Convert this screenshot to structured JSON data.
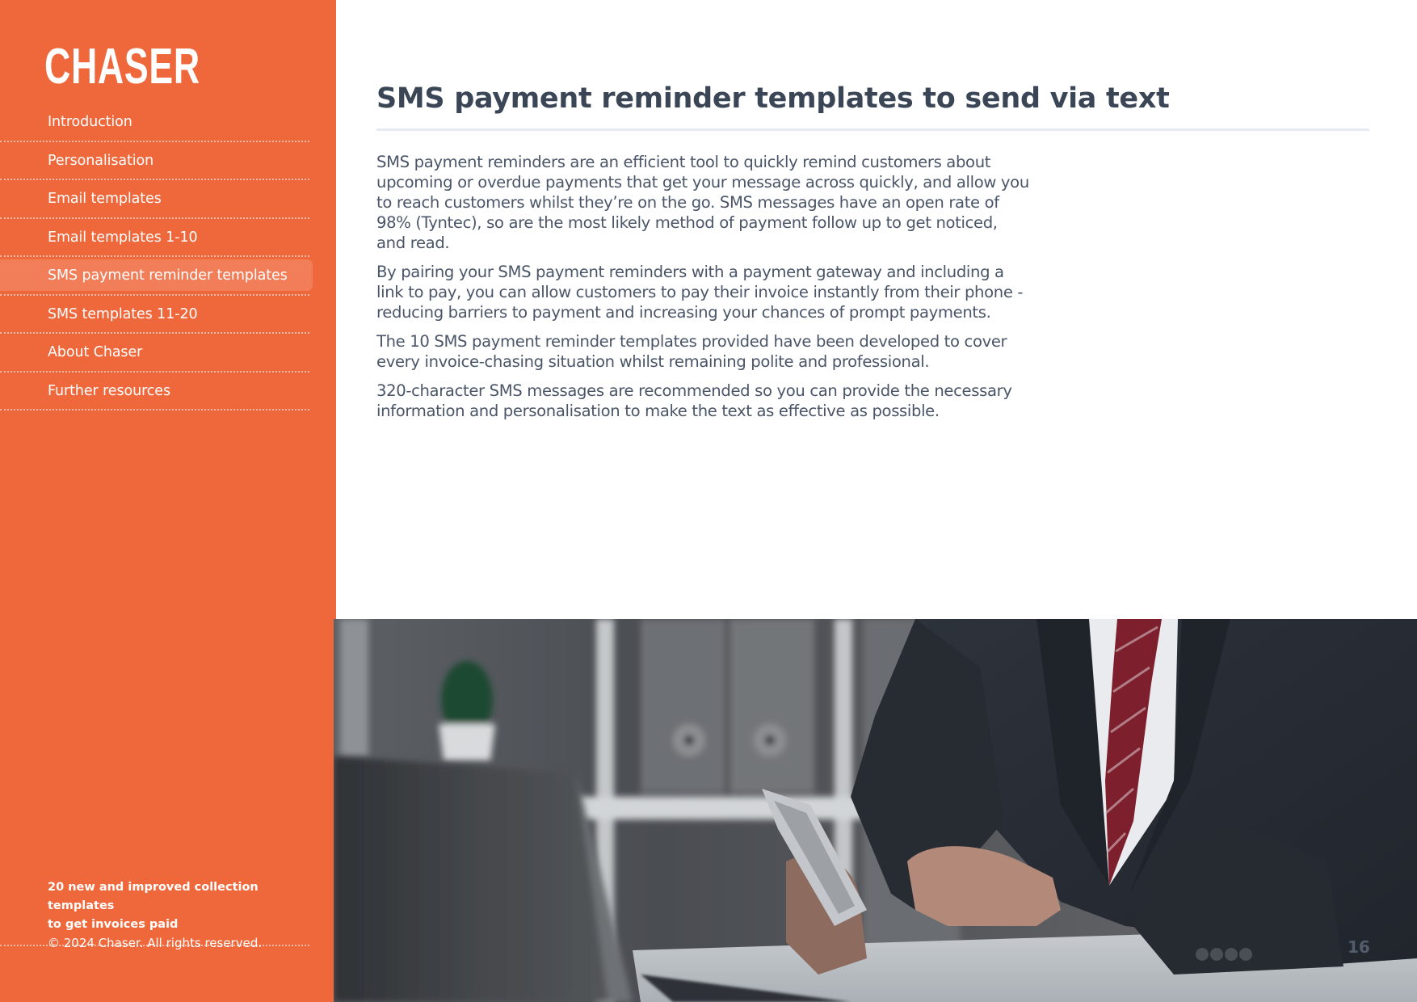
{
  "brand": {
    "logo_text": "CHASER",
    "accent_color": "#EF683C"
  },
  "sidebar": {
    "items": [
      {
        "label": "Introduction",
        "active": false
      },
      {
        "label": "Personalisation",
        "active": false
      },
      {
        "label": "Email templates",
        "active": false
      },
      {
        "label": "Email templates 1-10",
        "active": false
      },
      {
        "label": "SMS payment reminder templates",
        "active": true
      },
      {
        "label": "SMS templates 11-20",
        "active": false
      },
      {
        "label": "About Chaser",
        "active": false
      },
      {
        "label": "Further resources",
        "active": false
      }
    ],
    "footer": {
      "tagline_line1": "20 new and improved collection templates",
      "tagline_line2": "to get invoices paid",
      "copyright": "© 2024 Chaser. All rights reserved."
    }
  },
  "main": {
    "title": "SMS payment reminder templates to send via text",
    "paragraphs": [
      "SMS payment reminders are an efficient tool to quickly remind customers about upcoming or overdue payments that get your message across quickly, and allow you to reach customers whilst they’re on the go. SMS messages have an open rate of 98% (Tyntec), so are the most likely method of payment follow up to get noticed, and read.",
      "By pairing your SMS payment reminders with a payment gateway and including a link to pay, you can allow customers to pay their invoice instantly from their phone - reducing barriers to payment and increasing your chances of prompt payments.",
      "The 10 SMS payment reminder templates provided have been developed to cover every invoice-chasing situation whilst remaining polite and professional.",
      "320-character SMS messages are recommended so you can provide the necessary information and personalisation to make the text as effective as possible."
    ],
    "photo_description": "Businessman in dark suit and red striped tie holding a smartphone at a desk with a laptop",
    "page_number": "16"
  }
}
